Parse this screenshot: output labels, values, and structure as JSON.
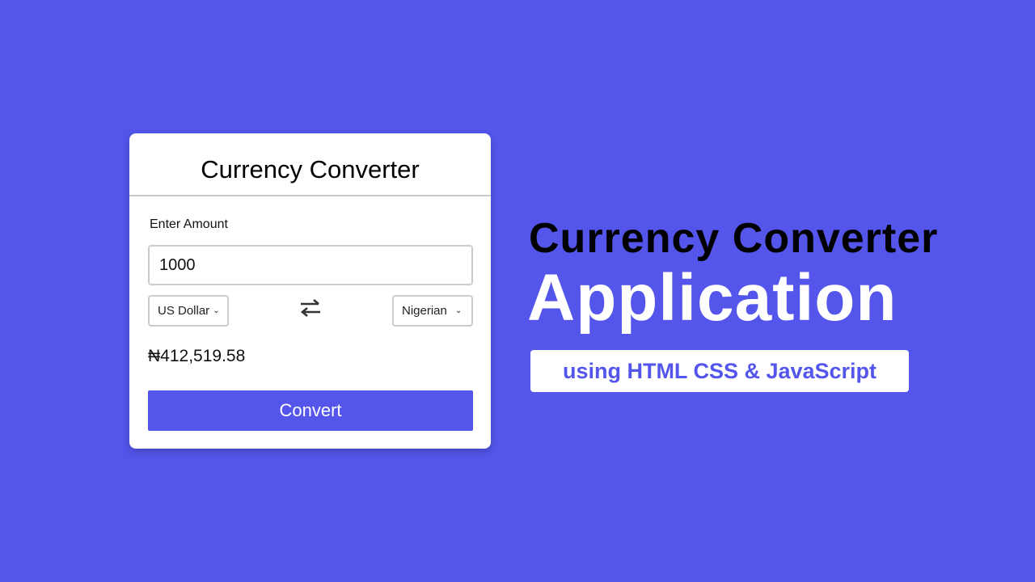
{
  "card": {
    "title": "Currency Converter",
    "amount_label": "Enter Amount",
    "amount_value": "1000",
    "from_currency": "US Dollar",
    "to_currency": "Nigerian",
    "result": "₦412,519.58",
    "convert_label": "Convert"
  },
  "banner": {
    "line1": "Currency Converter",
    "line2": "Application",
    "subtitle": "using HTML CSS & JavaScript"
  },
  "colors": {
    "accent": "#5355EB"
  }
}
